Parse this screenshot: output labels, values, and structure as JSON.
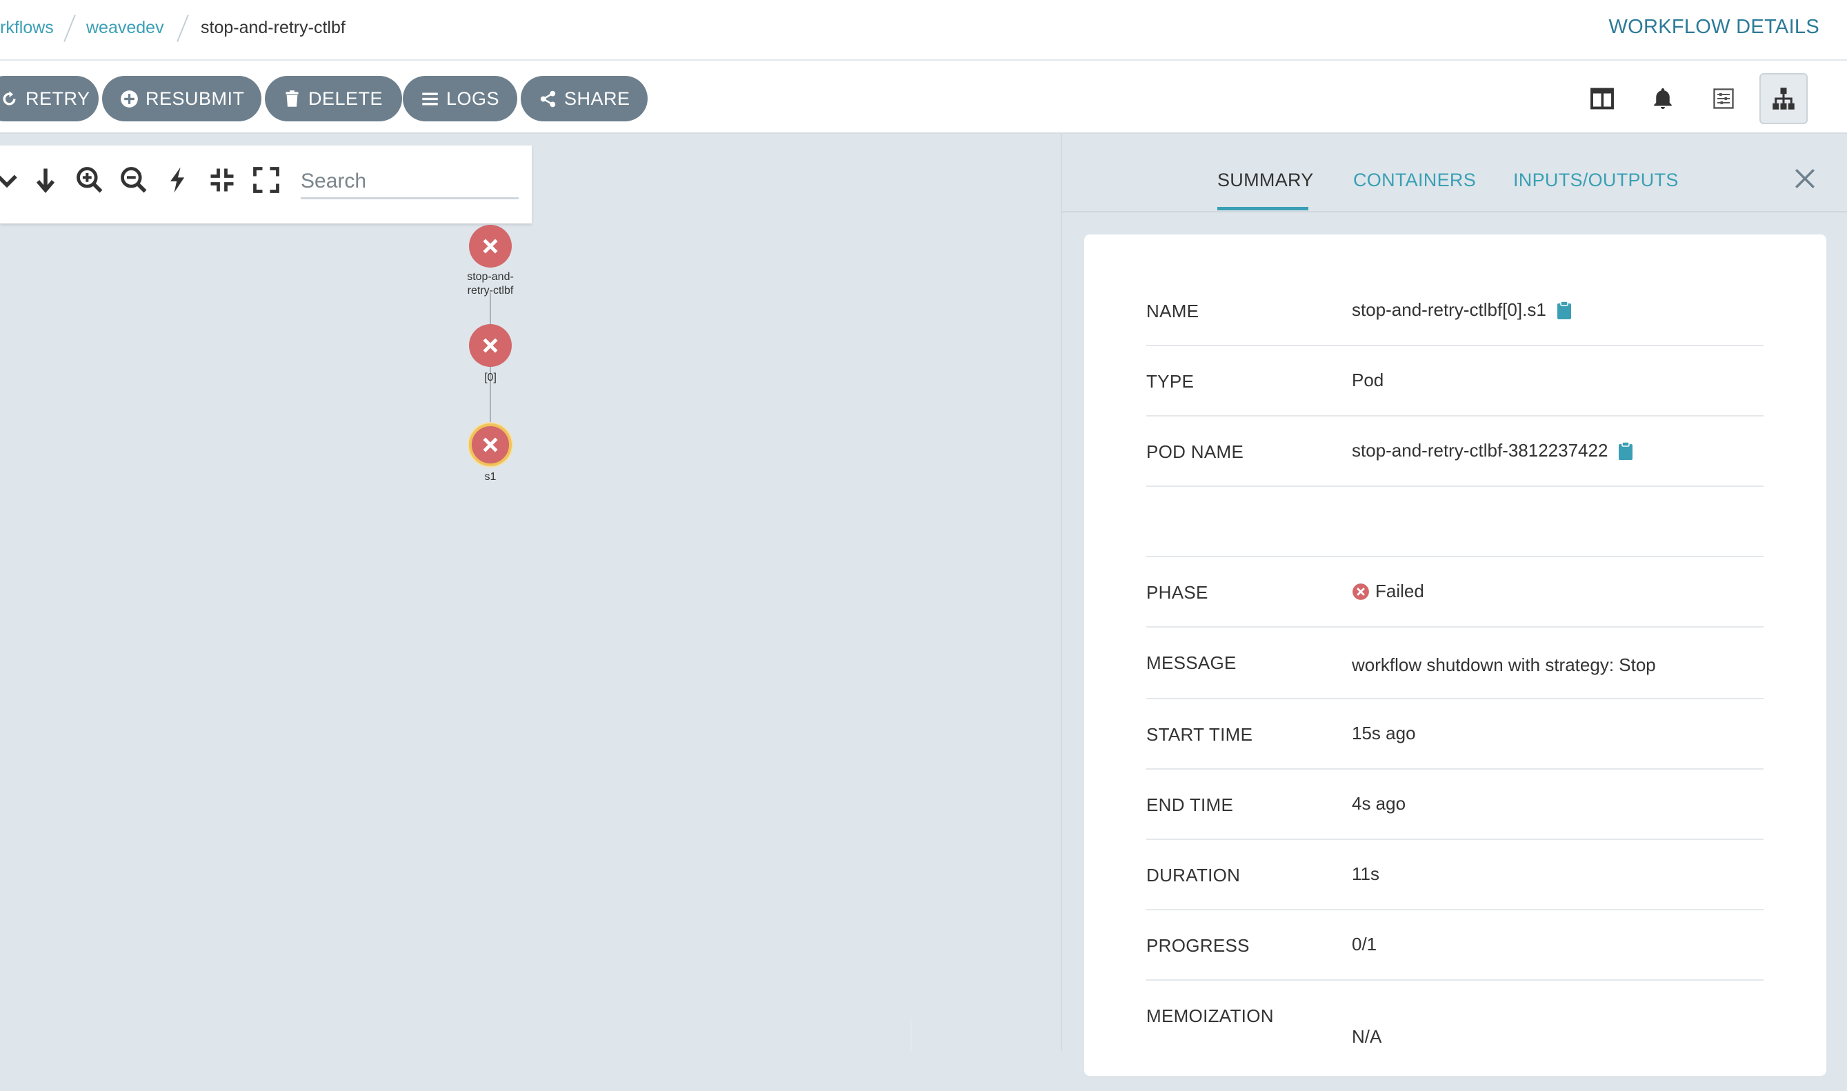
{
  "breadcrumbs": [
    {
      "label": "rkflows"
    },
    {
      "label": "weavedev"
    },
    {
      "label": "stop-and-retry-ctlbf"
    }
  ],
  "page_title": "WORKFLOW DETAILS",
  "toolbar": {
    "retry_label": "RETRY",
    "resubmit_label": "RESUBMIT",
    "delete_label": "DELETE",
    "logs_label": "LOGS",
    "share_label": "SHARE"
  },
  "graph": {
    "search_placeholder": "Search",
    "nodes": [
      {
        "label_line1": "stop-and-",
        "label_line2": "retry-ctlbf",
        "status": "failed"
      },
      {
        "label": "[0]",
        "status": "failed"
      },
      {
        "label": "s1",
        "status": "failed",
        "selected": true
      }
    ]
  },
  "details": {
    "tabs": [
      "SUMMARY",
      "CONTAINERS",
      "INPUTS/OUTPUTS"
    ],
    "active_tab": "SUMMARY",
    "fields": {
      "name": {
        "label": "NAME",
        "value": "stop-and-retry-ctlbf[0].s1"
      },
      "type": {
        "label": "TYPE",
        "value": "Pod"
      },
      "pod_name": {
        "label": "POD NAME",
        "value": "stop-and-retry-ctlbf-3812237422"
      },
      "phase": {
        "label": "PHASE",
        "value": "Failed"
      },
      "message": {
        "label": "MESSAGE",
        "value": "workflow shutdown with strategy: Stop"
      },
      "start_time": {
        "label": "START TIME",
        "value": "15s ago"
      },
      "end_time": {
        "label": "END TIME",
        "value": "4s ago"
      },
      "duration": {
        "label": "DURATION",
        "value": "11s"
      },
      "progress": {
        "label": "PROGRESS",
        "value": "0/1"
      },
      "memoization": {
        "label": "MEMOIZATION",
        "value": "N/A"
      }
    }
  },
  "colors": {
    "accent": "#3a9fb5",
    "button_bg": "#6d7f8c",
    "failed": "#d3676a",
    "selected_ring": "#f0c35a",
    "canvas_bg": "#dee6eb"
  },
  "icons": [
    "retry-icon",
    "resubmit-icon",
    "delete-icon",
    "logs-icon",
    "share-icon",
    "split-view-icon",
    "bell-icon",
    "settings-list-icon",
    "workflow-graph-icon",
    "collapse-icon",
    "sort-down-icon",
    "zoom-in-icon",
    "zoom-out-icon",
    "lightning-icon",
    "compress-icon",
    "expand-icon",
    "close-icon",
    "clipboard-icon",
    "failed-icon"
  ]
}
